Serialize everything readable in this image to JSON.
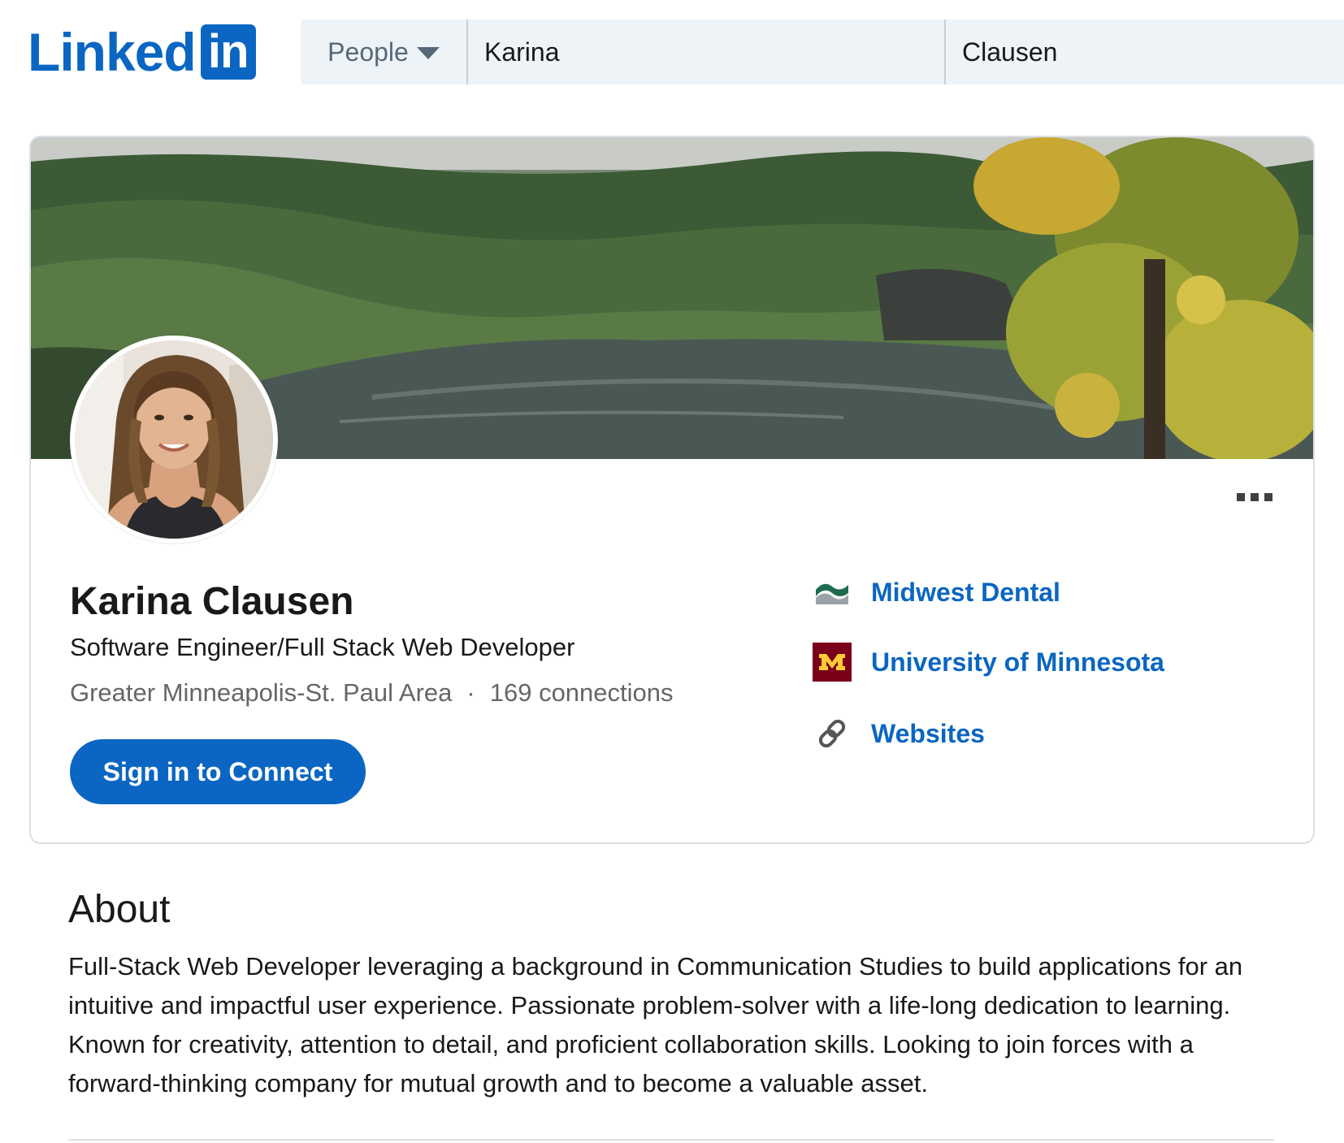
{
  "header": {
    "logo_text": "Linked",
    "logo_box_text": "in",
    "search": {
      "type_label": "People",
      "first_name_value": "Karina",
      "last_name_value": "Clausen"
    }
  },
  "profile": {
    "name": "Karina Clausen",
    "headline": "Software Engineer/Full Stack Web Developer",
    "location": "Greater Minneapolis-St. Paul Area",
    "separator": "·",
    "connections": "169 connections",
    "connect_button": "Sign in to Connect",
    "more_icon": "ellipsis-icon",
    "side_items": [
      {
        "label": "Midwest Dental",
        "icon": "midwest-dental-logo"
      },
      {
        "label": "University of Minnesota",
        "icon": "university-of-minnesota-logo"
      },
      {
        "label": "Websites",
        "icon": "link-icon"
      }
    ]
  },
  "about": {
    "title": "About",
    "text": "Full-Stack Web Developer leveraging a background in Communication Studies to build applications for an intuitive and impactful user experience. Passionate problem-solver with a life-long dedication to learning. Known for creativity, attention to detail, and proficient collaboration skills. Looking to join forces with a forward-thinking company for mutual growth and to become a valuable asset."
  },
  "colors": {
    "brand_blue": "#0a66c2",
    "search_bg": "#eef3f8",
    "umn_maroon": "#7a0019",
    "umn_gold": "#ffcc33",
    "midwest_green": "#1f6b4f"
  }
}
